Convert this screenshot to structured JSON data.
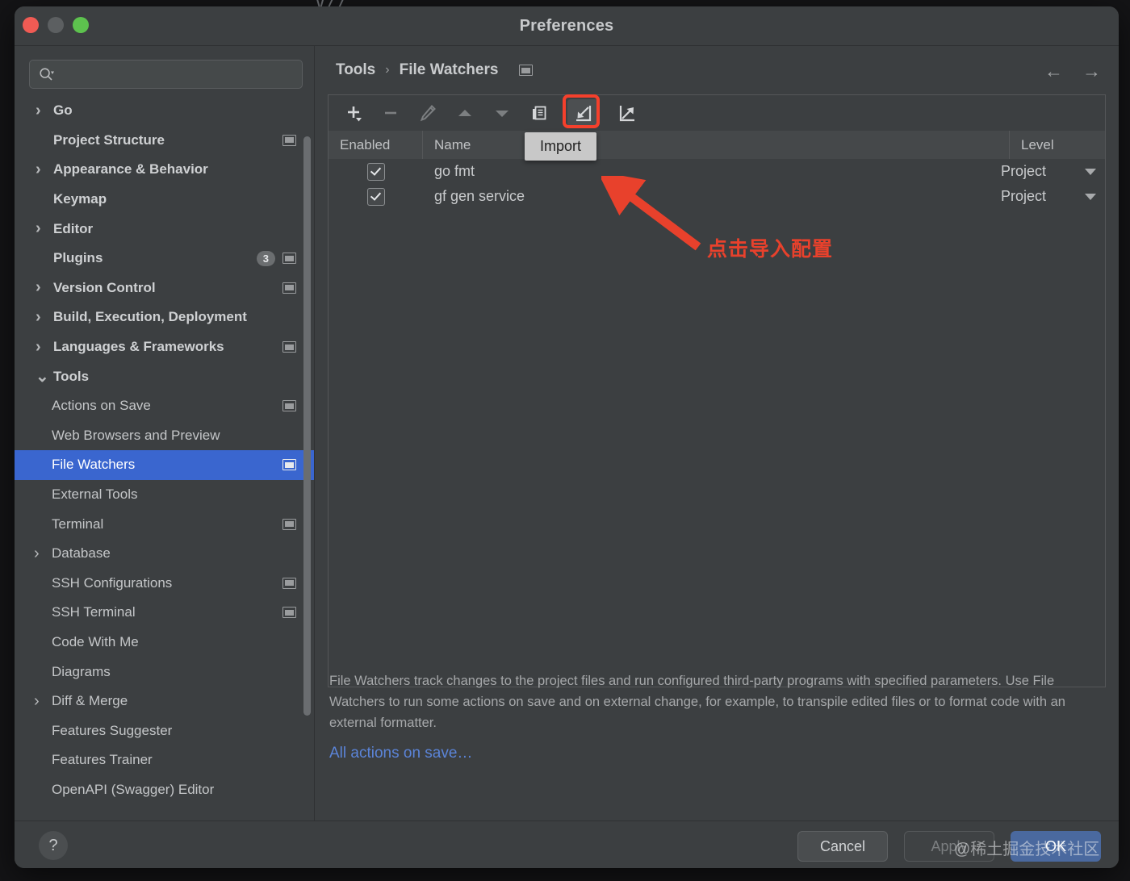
{
  "window": {
    "title": "Preferences",
    "traffic_lights": [
      "close-red",
      "minimize-gray",
      "zoom-green"
    ]
  },
  "sidebar": {
    "search": {
      "value": "",
      "placeholder": ""
    },
    "items": [
      {
        "label": "Go",
        "expandable": true,
        "expanded": false,
        "indent": 0,
        "bold": true,
        "badge": "",
        "project_icon": false
      },
      {
        "label": "Project Structure",
        "expandable": false,
        "expanded": false,
        "indent": 0,
        "bold": true,
        "badge": "",
        "project_icon": true
      },
      {
        "label": "Appearance & Behavior",
        "expandable": true,
        "expanded": false,
        "indent": 0,
        "bold": true,
        "badge": "",
        "project_icon": false
      },
      {
        "label": "Keymap",
        "expandable": false,
        "expanded": false,
        "indent": 0,
        "bold": true,
        "badge": "",
        "project_icon": false
      },
      {
        "label": "Editor",
        "expandable": true,
        "expanded": false,
        "indent": 0,
        "bold": true,
        "badge": "",
        "project_icon": false
      },
      {
        "label": "Plugins",
        "expandable": false,
        "expanded": false,
        "indent": 0,
        "bold": true,
        "badge": "3",
        "project_icon": true
      },
      {
        "label": "Version Control",
        "expandable": true,
        "expanded": false,
        "indent": 0,
        "bold": true,
        "badge": "",
        "project_icon": true
      },
      {
        "label": "Build, Execution, Deployment",
        "expandable": true,
        "expanded": false,
        "indent": 0,
        "bold": true,
        "badge": "",
        "project_icon": false
      },
      {
        "label": "Languages & Frameworks",
        "expandable": true,
        "expanded": false,
        "indent": 0,
        "bold": true,
        "badge": "",
        "project_icon": true
      },
      {
        "label": "Tools",
        "expandable": true,
        "expanded": true,
        "indent": 0,
        "bold": true,
        "badge": "",
        "project_icon": false
      },
      {
        "label": "Actions on Save",
        "expandable": false,
        "expanded": false,
        "indent": 1,
        "bold": false,
        "badge": "",
        "project_icon": true
      },
      {
        "label": "Web Browsers and Preview",
        "expandable": false,
        "expanded": false,
        "indent": 1,
        "bold": false,
        "badge": "",
        "project_icon": false
      },
      {
        "label": "File Watchers",
        "expandable": false,
        "expanded": false,
        "indent": 1,
        "bold": false,
        "badge": "",
        "project_icon": true,
        "selected": true
      },
      {
        "label": "External Tools",
        "expandable": false,
        "expanded": false,
        "indent": 1,
        "bold": false,
        "badge": "",
        "project_icon": false
      },
      {
        "label": "Terminal",
        "expandable": false,
        "expanded": false,
        "indent": 1,
        "bold": false,
        "badge": "",
        "project_icon": true
      },
      {
        "label": "Database",
        "expandable": true,
        "expanded": false,
        "indent": 1,
        "bold": false,
        "badge": "",
        "project_icon": false
      },
      {
        "label": "SSH Configurations",
        "expandable": false,
        "expanded": false,
        "indent": 1,
        "bold": false,
        "badge": "",
        "project_icon": true
      },
      {
        "label": "SSH Terminal",
        "expandable": false,
        "expanded": false,
        "indent": 1,
        "bold": false,
        "badge": "",
        "project_icon": true
      },
      {
        "label": "Code With Me",
        "expandable": false,
        "expanded": false,
        "indent": 1,
        "bold": false,
        "badge": "",
        "project_icon": false
      },
      {
        "label": "Diagrams",
        "expandable": false,
        "expanded": false,
        "indent": 1,
        "bold": false,
        "badge": "",
        "project_icon": false
      },
      {
        "label": "Diff & Merge",
        "expandable": true,
        "expanded": false,
        "indent": 1,
        "bold": false,
        "badge": "",
        "project_icon": false
      },
      {
        "label": "Features Suggester",
        "expandable": false,
        "expanded": false,
        "indent": 1,
        "bold": false,
        "badge": "",
        "project_icon": false
      },
      {
        "label": "Features Trainer",
        "expandable": false,
        "expanded": false,
        "indent": 1,
        "bold": false,
        "badge": "",
        "project_icon": false
      },
      {
        "label": "OpenAPI (Swagger) Editor",
        "expandable": false,
        "expanded": false,
        "indent": 1,
        "bold": false,
        "badge": "",
        "project_icon": false
      }
    ]
  },
  "main": {
    "breadcrumb": {
      "parent": "Tools",
      "separator": "›",
      "current": "File Watchers"
    },
    "nav": {
      "back": "←",
      "forward": "→"
    },
    "toolbar": [
      {
        "name": "add-button",
        "icon": "plus-icon",
        "enabled": true
      },
      {
        "name": "remove-button",
        "icon": "minus-icon",
        "enabled": false
      },
      {
        "name": "edit-button",
        "icon": "pencil-icon",
        "enabled": false
      },
      {
        "name": "move-up-button",
        "icon": "arrow-up-icon",
        "enabled": false
      },
      {
        "name": "move-down-button",
        "icon": "arrow-down-icon",
        "enabled": false
      },
      {
        "name": "copy-button",
        "icon": "copy-icon",
        "enabled": true
      },
      {
        "name": "import-button",
        "icon": "import-icon",
        "enabled": true,
        "highlighted": true
      },
      {
        "name": "export-button",
        "icon": "export-icon",
        "enabled": true
      }
    ],
    "tooltip": {
      "text": "Import"
    },
    "table": {
      "columns": [
        "Enabled",
        "Name",
        "Level"
      ],
      "rows": [
        {
          "enabled": true,
          "name": "go fmt",
          "level": "Project"
        },
        {
          "enabled": true,
          "name": "gf gen service",
          "level": "Project"
        }
      ]
    },
    "description": "File Watchers track changes to the project files and run configured third-party programs with specified parameters. Use File Watchers to run some actions on save and on external change, for example, to transpile edited files or to format code with an external formatter.",
    "link": "All actions on save…"
  },
  "footer": {
    "help": "?",
    "cancel": "Cancel",
    "apply": "Apply",
    "ok": "OK"
  },
  "annotation": {
    "text": "点击导入配置",
    "color": "#e8412c"
  },
  "watermark": "@稀土掘金技术社区",
  "background_artifacts": [
    "∨//"
  ]
}
